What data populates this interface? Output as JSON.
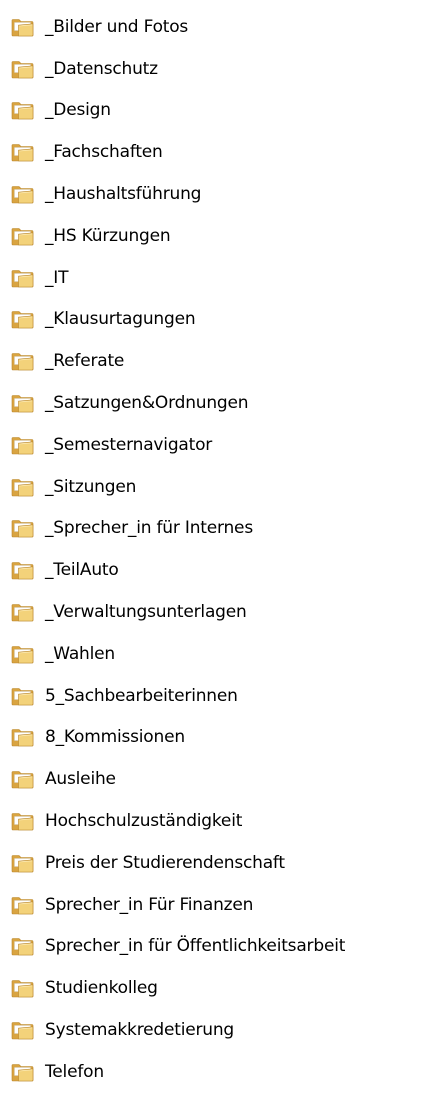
{
  "folders": [
    {
      "name": "_Bilder und Fotos",
      "icon": "folder-icon"
    },
    {
      "name": "_Datenschutz",
      "icon": "folder-icon"
    },
    {
      "name": "_Design",
      "icon": "folder-icon"
    },
    {
      "name": "_Fachschaften",
      "icon": "folder-icon"
    },
    {
      "name": "_Haushaltsführung",
      "icon": "folder-icon"
    },
    {
      "name": "_HS Kürzungen",
      "icon": "folder-icon"
    },
    {
      "name": "_IT",
      "icon": "folder-icon"
    },
    {
      "name": "_Klausurtagungen",
      "icon": "folder-icon"
    },
    {
      "name": "_Referate",
      "icon": "folder-icon"
    },
    {
      "name": "_Satzungen&Ordnungen",
      "icon": "folder-icon"
    },
    {
      "name": "_Semesternavigator",
      "icon": "folder-icon"
    },
    {
      "name": "_Sitzungen",
      "icon": "folder-icon"
    },
    {
      "name": "_Sprecher_in für Internes",
      "icon": "folder-icon"
    },
    {
      "name": "_TeilAuto",
      "icon": "folder-icon"
    },
    {
      "name": "_Verwaltungsunterlagen",
      "icon": "folder-icon"
    },
    {
      "name": "_Wahlen",
      "icon": "folder-icon"
    },
    {
      "name": "5_Sachbearbeiterinnen",
      "icon": "folder-icon"
    },
    {
      "name": "8_Kommissionen",
      "icon": "folder-icon"
    },
    {
      "name": "Ausleihe",
      "icon": "folder-icon"
    },
    {
      "name": "Hochschulzuständigkeit",
      "icon": "folder-icon"
    },
    {
      "name": "Preis der Studierendenschaft",
      "icon": "folder-icon"
    },
    {
      "name": "Sprecher_in Für Finanzen",
      "icon": "folder-icon"
    },
    {
      "name": "Sprecher_in für Öffentlichkeitsarbeit",
      "icon": "folder-icon"
    },
    {
      "name": "Studienkolleg",
      "icon": "folder-icon"
    },
    {
      "name": "Systemakkredetierung",
      "icon": "folder-icon"
    },
    {
      "name": "Telefon",
      "icon": "folder-icon"
    }
  ],
  "colors": {
    "folder_back": "#d9a441",
    "folder_front": "#f3d27a",
    "folder_edge": "#b9852a",
    "folder_paper": "#ffffff",
    "text": "#000000"
  }
}
